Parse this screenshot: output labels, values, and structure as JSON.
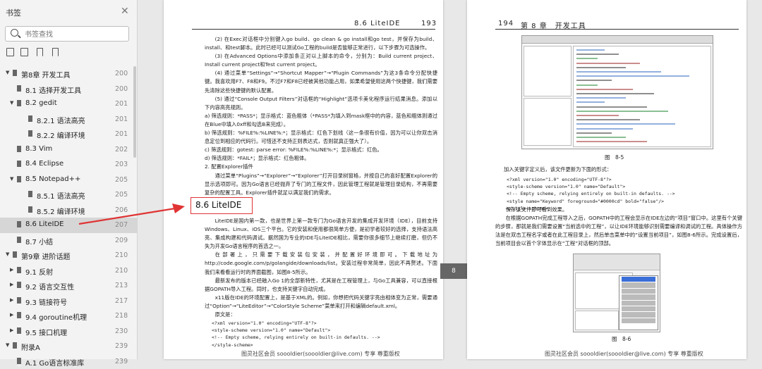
{
  "sidebar": {
    "title": "书签",
    "search_placeholder": "书签查找",
    "items": [
      {
        "label": "第8章 开发工具",
        "page": "200",
        "level": 0,
        "expanded": true
      },
      {
        "label": "8.1 选择开发工具",
        "page": "200",
        "level": 1
      },
      {
        "label": "8.2 gedit",
        "page": "201",
        "level": 1,
        "expanded": true
      },
      {
        "label": "8.2.1 语法高亮",
        "page": "201",
        "level": 2
      },
      {
        "label": "8.2.2 编译环境",
        "page": "201",
        "level": 2
      },
      {
        "label": "8.3 Vim",
        "page": "202",
        "level": 1
      },
      {
        "label": "8.4 Eclipse",
        "page": "203",
        "level": 1
      },
      {
        "label": "8.5 Notepad++",
        "page": "205",
        "level": 1,
        "expanded": true
      },
      {
        "label": "8.5.1 语法高亮",
        "page": "205",
        "level": 2
      },
      {
        "label": "8.5.2 编译环境",
        "page": "206",
        "level": 2
      },
      {
        "label": "8.6 LiteIDE",
        "page": "207",
        "level": 1,
        "active": true
      },
      {
        "label": "8.7 小结",
        "page": "209",
        "level": 1
      },
      {
        "label": "第9章 进阶话题",
        "page": "210",
        "level": 0,
        "expanded": true
      },
      {
        "label": "9.1 反射",
        "page": "210",
        "level": 1,
        "collapsed": true
      },
      {
        "label": "9.2 语言交互性",
        "page": "213",
        "level": 1,
        "collapsed": true
      },
      {
        "label": "9.3 链接符号",
        "page": "217",
        "level": 1,
        "collapsed": true
      },
      {
        "label": "9.4 goroutine机理",
        "page": "218",
        "level": 1,
        "collapsed": true
      },
      {
        "label": "9.5 接口机理",
        "page": "230",
        "level": 1,
        "collapsed": true
      },
      {
        "label": "附录A",
        "page": "239",
        "level": 0,
        "expanded": true
      },
      {
        "label": "A.1 Go语言标准库",
        "page": "239",
        "level": 1
      }
    ]
  },
  "left_page": {
    "header_title": "8.6 LiteIDE",
    "header_page": "193",
    "section_title": "8.6 LiteIDE",
    "paragraphs_top": [
      "(2) 在Exec对话框中分别键入go build、go clean & go install和go test，并保存为build、install、和test脚本。此时已经可以测试Go工程的build是否能够正常进行，以下步骤为可选操作。",
      "(3) 在Advanced Options中添加条正对以上脚本的命令，分别为：Build current project、Install current project和Test current project。",
      "(4) 通过菜单“Settings”→“Shortcut Mapper”→“Plugin Commands”为这3条命令分配快捷键。我喜欢用F7、F8和F9。不过F7和F8已经被其他功能占用，如果希望使用这两个快捷键，我们需要先清除这些快捷键的默认配置。",
      "(5) 通过“Console Output Filters”对话框的“Highlight”选项卡美化程序运行结果消息。添加以下内容高亮规则。",
      "a) 筛选规则：*PASS*；显示格式：蓝色粗体（*PASS*为填入到mask框中的内容，蓝色和粗体则通过在Blue中填入0xff和勾选B来完成）。",
      "b) 筛选规则：%FILE%:%LINE%:*；显示格式：红色下划线（这一条很有价值，因为可以让你双击消息定位到相应的代码行。可惜还不支持正则表达式，否则就真正强大了）。",
      "c) 筛选规则：gotest: parse error: %FILE%:%LINE%:*；显示格式：红色。",
      "d) 筛选规则：*FAIL*；显示格式：红色粗体。",
      "2. 配置Explorer插件",
      "通过菜单“Plugins”→“Explorer”→“Explorer”打开目录树窗格，并按自己的喜好配置Explorer的显示选项即可。因为Go语言已经抛弃了专门的工程文件，因此管理工程就是管理目录结构，不再需要复杂的配置工具。Explorer插件就足以满足我们的需求。"
    ],
    "paragraphs_bottom": [
      "LiteIDE是国内第一款，也是世界上第一款专门为Go语言开发的集成开发环境（IDE），目前支持Windows、Linux、iOS三个平台。它的安装和使用都很简单方便，是初学者较好的选择，支持语法高亮、集成构建和代码调试。据然国为专业的IDE与LiteIDE相比，需要你很多细节上继续打磨，但仍不失为开发Go语言程序的首选之一。",
      "在部署上，只需要下载安装包安装，并配置好环境即可。下载地址为http://code.google.com/p/golangide/downloads/list。安装过程非常简单，因此不再赘述。下面我们来看看运行时的界面截图，如图8-5所示。",
      "最新发布的版本已经融入Go 1的全部新特性，尤其是在工程管理上，与Go工具兼容，可以直接根据GOPATH导入工程。同时，也支持关键字自动完成。",
      "x11版在IDE的环境配置上，是基于XML的。例如，你想把代码关键字亮由相体变为正常，需要通过“Option”→“LiteEditor”→“ColorStyle Scheme”菜单来打开和编辑default.xml。",
      "原文是："
    ],
    "code": [
      "<?xml version=\"1.0\" encoding=\"UTF-8\"?>",
      "<style-scheme version=\"1.0\" name=\"Default\">",
      "<!-- Empty scheme, relying entirely on built-in defaults. -->",
      "</style-scheme>"
    ],
    "footer": "图灵社区会员 soooldier(soooldier@live.com) 专享 尊重版权"
  },
  "page_badge": "8",
  "right_page": {
    "header_page": "194",
    "header_chapter": "第 8 章　开发工具",
    "fig5_caption": "图　8-5",
    "para_1": "加入关键字定义后，该文件更新为下面的形式：",
    "code": [
      "<?xml version=\"1.0\" encoding=\"UTF-8\"?>",
      "<style-scheme version=\"1.0\" name=\"Default\">",
      "<!-- Empty scheme, relying entirely on built-in defaults. -->",
      "<style name=\"Keyword\" foreground=\"#0000cd\" bold=\"false\"/>",
      "</style-scheme>"
    ],
    "paragraphs": [
      "保存该文件即可看到效果。",
      "在根据GOPATH完成工程导入之后，GOPATH中的工程会显示在IDE左边的“项目”窗口中。这里有个关键的步骤，那就是我们需要设置“当前选中的工程”，以让IDE环境能够识别需要编译和调试的工程。具体操作方法是在双击工程名字或者在此工程目录上，然后单击菜单中的“设置当前项目”，如图8-6所示。完成设置后，当前项目会以首个字体显示在“工程”对话框的顶部。"
    ],
    "fig6_caption": "图　8-6",
    "footer": "图灵社区会员 soooldier(soooldier@live.com) 专享 尊重版权"
  },
  "colors": {
    "accent_red": "#e03434",
    "active_bg": "#d6d6d6"
  }
}
